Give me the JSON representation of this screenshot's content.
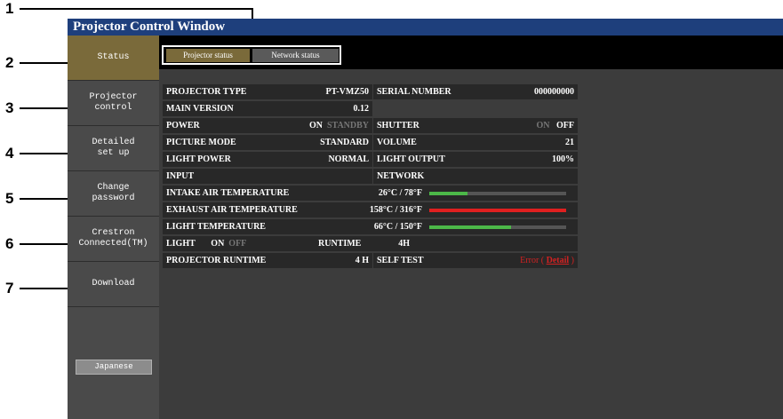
{
  "callouts": [
    "1",
    "2",
    "3",
    "4",
    "5",
    "6",
    "7"
  ],
  "window": {
    "title": "Projector Control Window"
  },
  "sidebar": {
    "items": [
      {
        "label": "Status"
      },
      {
        "label": "Projector\ncontrol"
      },
      {
        "label": "Detailed\nset up"
      },
      {
        "label": "Change\npassword"
      },
      {
        "label": "Crestron\nConnected(TM)"
      },
      {
        "label": "Download"
      }
    ],
    "language_button": "Japanese"
  },
  "tabs": {
    "projector_status": "Projector status",
    "network_status": "Network status"
  },
  "status": {
    "projector_type_label": "PROJECTOR TYPE",
    "projector_type": "PT-VMZ50",
    "serial_label": "SERIAL NUMBER",
    "serial": "000000000",
    "main_version_label": "MAIN VERSION",
    "main_version": "0.12",
    "power_label": "POWER",
    "power_on": "ON",
    "power_standby": "STANDBY",
    "shutter_label": "SHUTTER",
    "shutter_on": "ON",
    "shutter_off": "OFF",
    "picture_mode_label": "PICTURE MODE",
    "picture_mode": "STANDARD",
    "volume_label": "VOLUME",
    "volume": "21",
    "light_power_label": "LIGHT POWER",
    "light_power": "NORMAL",
    "light_output_label": "LIGHT OUTPUT",
    "light_output": "100%",
    "input_label": "INPUT",
    "input": "NETWORK",
    "intake_label": "INTAKE AIR TEMPERATURE",
    "intake": "26°C / 78°F",
    "exhaust_label": "EXHAUST AIR TEMPERATURE",
    "exhaust": "158°C / 316°F",
    "light_temp_label": "LIGHT TEMPERATURE",
    "light_temp": "66°C / 150°F",
    "light_label": "LIGHT",
    "light_on": "ON",
    "light_off": "OFF",
    "runtime_label": "RUNTIME",
    "runtime": "4H",
    "projector_runtime_label": "PROJECTOR RUNTIME",
    "projector_runtime": "4 H",
    "self_test_label": "SELF TEST",
    "self_test_prefix": "Error (",
    "self_test_link": "Detail",
    "self_test_suffix": ")"
  },
  "temperature_levels": {
    "intake": 0.28,
    "exhaust": 1.0,
    "light": 0.6
  },
  "colors": {
    "title_bar": "#1e3f7c",
    "active_nav": "#7a6a3a",
    "bar_green": "#4cb848",
    "bar_red": "#e02020",
    "error_red": "#d22222"
  }
}
